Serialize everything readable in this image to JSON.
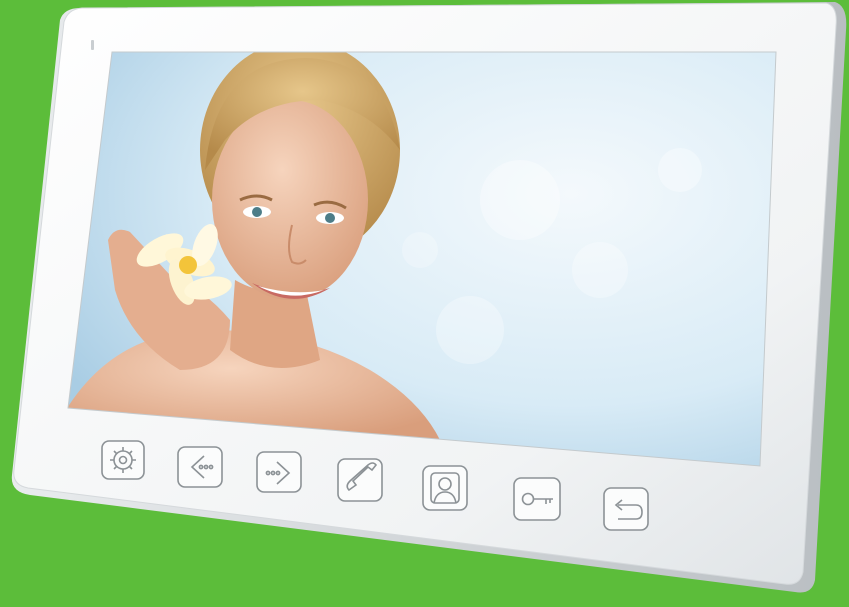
{
  "background_color": "#5cbd3a",
  "device": {
    "bezel_color": "#f7f8f8",
    "edge_color": "#cfd3d6",
    "screen_sky_color": "#cfe6f3",
    "skin_color": "#e8b79a",
    "hair_color": "#c9a15f",
    "flower_color": "#fff7d9",
    "flower_center_color": "#f3c43a"
  },
  "buttons": [
    {
      "name": "menu-button",
      "icon": "gear-icon"
    },
    {
      "name": "previous-button",
      "icon": "chevron-left-icon"
    },
    {
      "name": "next-button",
      "icon": "chevron-right-icon"
    },
    {
      "name": "call-button",
      "icon": "handset-icon"
    },
    {
      "name": "monitor-button",
      "icon": "person-icon"
    },
    {
      "name": "unlock-button",
      "icon": "key-icon"
    },
    {
      "name": "back-button",
      "icon": "back-arrow-icon"
    }
  ]
}
